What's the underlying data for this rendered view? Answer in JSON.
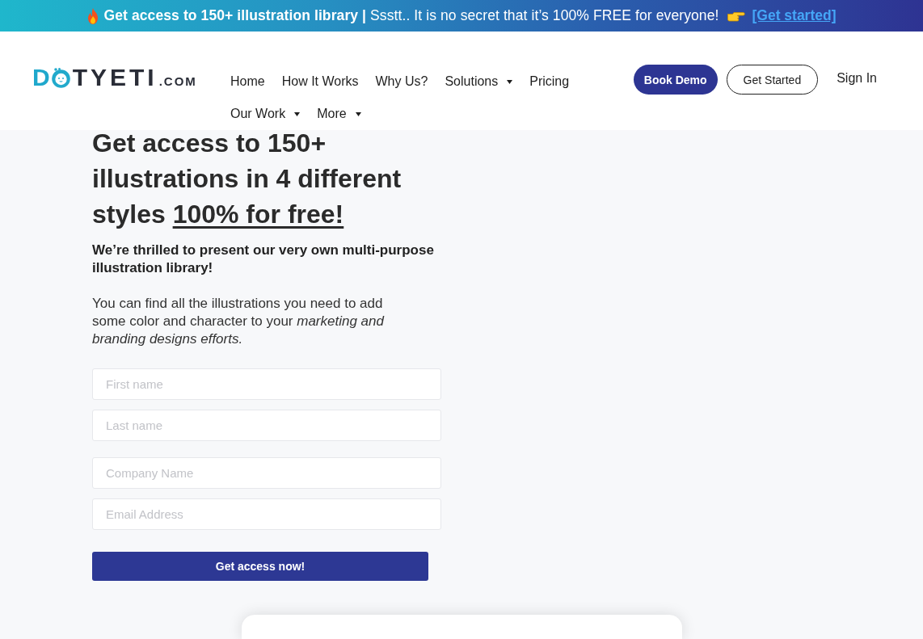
{
  "promo_banner": {
    "text": "**Get access to 150+ illustration library |** Ssstt.. It is no secret that it’s 100% FREE for everyone!",
    "link": "[Get started]"
  },
  "header": {
    "logo": {
      "lead": "D",
      "main": "TYETI",
      "suffix": ".COM"
    },
    "nav": [
      {
        "label": "Home",
        "dropdown": false
      },
      {
        "label": "How It Works",
        "dropdown": false
      },
      {
        "label": "Why Us?",
        "dropdown": false
      },
      {
        "label": "Solutions",
        "dropdown": true
      },
      {
        "label": "Pricing",
        "dropdown": false
      },
      {
        "label": "Our Work",
        "dropdown": true
      },
      {
        "label": "More",
        "dropdown": true
      }
    ],
    "buttons": [
      {
        "label": "Book Demo",
        "kind": "primary"
      },
      {
        "label": "Get Started",
        "kind": "outline"
      },
      {
        "label": "Sign In",
        "kind": "text"
      }
    ]
  },
  "hero": {
    "title": "Get access to 150+ illustrations in 4 different styles",
    "title_underlined": "100% for free!",
    "intro": "We’re thrilled to present our very own multi-purpose illustration library!",
    "body": "You can find all the illustrations you need to add some color and character to your *marketing and branding designs efforts.*"
  },
  "form": {
    "fields": [
      {
        "placeholder": "First name"
      },
      {
        "placeholder": "Last name"
      },
      {
        "placeholder": "Company Name"
      },
      {
        "placeholder": "Email Address"
      }
    ],
    "submit": "Get access now!"
  }
}
